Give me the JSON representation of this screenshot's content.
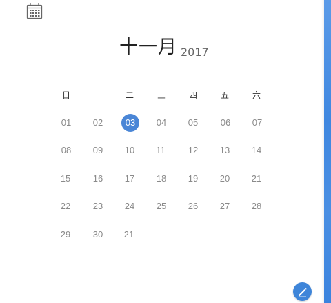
{
  "app": {
    "accent_color": "#4a86d6",
    "side_color": "#3f87e0"
  },
  "toolbar": {
    "calendar_icon": "calendar-icon"
  },
  "header": {
    "month": "十一月",
    "year": "2017"
  },
  "weekdays": [
    "日",
    "一",
    "二",
    "三",
    "四",
    "五",
    "六"
  ],
  "days": [
    [
      "01",
      "02",
      "03",
      "04",
      "05",
      "06",
      "07"
    ],
    [
      "08",
      "09",
      "10",
      "11",
      "12",
      "13",
      "14"
    ],
    [
      "15",
      "16",
      "17",
      "18",
      "19",
      "20",
      "21"
    ],
    [
      "22",
      "23",
      "24",
      "25",
      "26",
      "27",
      "28"
    ],
    [
      "29",
      "30",
      "21"
    ]
  ],
  "selected_day": "03",
  "fab": {
    "icon": "pencil-icon"
  }
}
